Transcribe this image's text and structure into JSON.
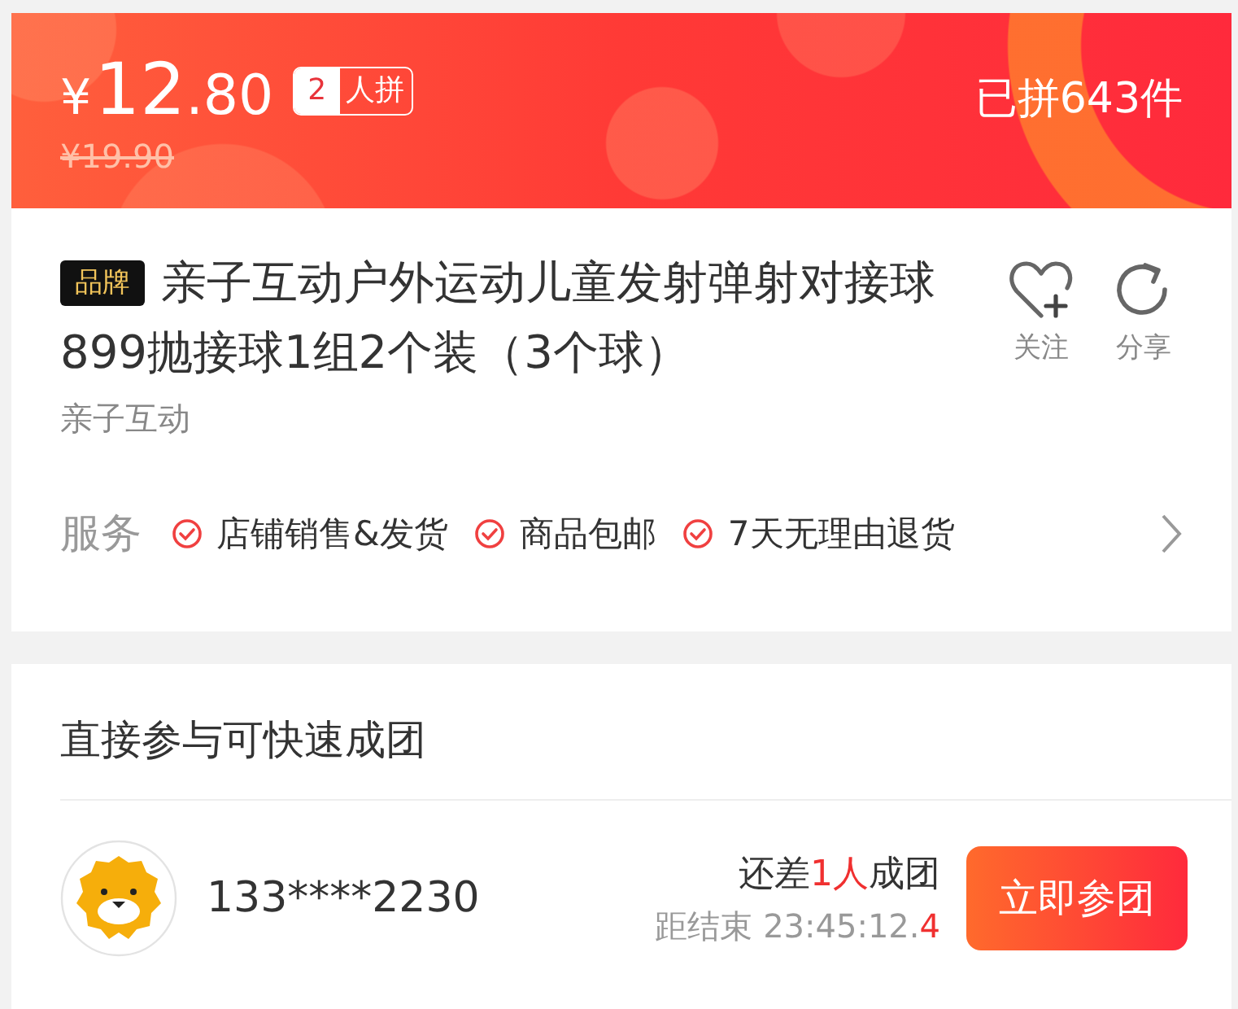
{
  "price_banner": {
    "currency": "¥",
    "price_integer": "12",
    "price_decimal": ".80",
    "group_size": "2",
    "group_label": "人拼",
    "original_price": "¥19.90",
    "sold": "已拼643件"
  },
  "product": {
    "brand_tag": "品牌",
    "title": "亲子互动户外运动儿童发射弹射对接球899抛接球1组2个装（3个球）",
    "brand": "亲子互动",
    "actions": [
      {
        "kind": "follow",
        "label": "关注"
      },
      {
        "kind": "share",
        "label": "分享"
      }
    ],
    "services_label": "服务",
    "services": [
      "店铺销售&发货",
      "商品包邮",
      "7天无理由退货"
    ]
  },
  "group_section": {
    "title": "直接参与可快速成团",
    "groups": [
      {
        "user": "133****2230",
        "need_prefix": "还差",
        "need_count": "1人",
        "need_suffix": "成团",
        "countdown_label": "距结束",
        "countdown": "23:45:12.",
        "countdown_tenths": "4",
        "button": "立即参团"
      }
    ]
  }
}
